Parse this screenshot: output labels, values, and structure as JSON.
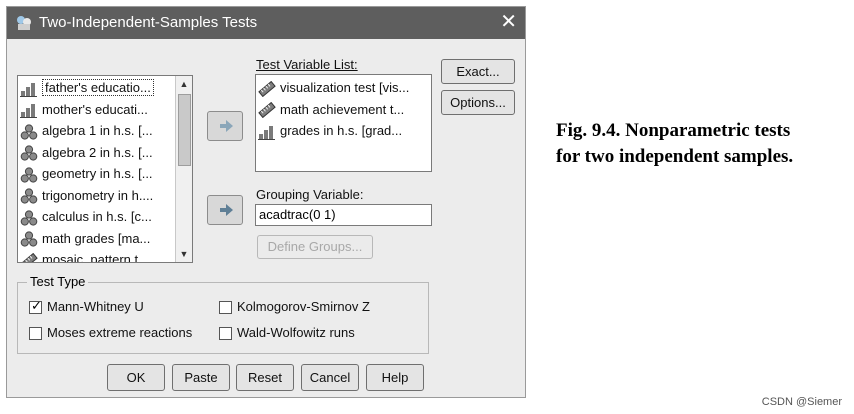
{
  "window": {
    "title": "Two-Independent-Samples Tests",
    "close_symbol": "✕"
  },
  "source_list": {
    "items": [
      {
        "label": "father's educatio...",
        "icon": "ordinal-bar-icon",
        "selected": true
      },
      {
        "label": "mother's educati...",
        "icon": "ordinal-bar-icon"
      },
      {
        "label": "algebra 1 in h.s. [...",
        "icon": "nominal-circles-icon"
      },
      {
        "label": "algebra 2 in h.s. [...",
        "icon": "nominal-circles-icon"
      },
      {
        "label": "geometry in h.s. [...",
        "icon": "nominal-circles-icon"
      },
      {
        "label": "trigonometry in h....",
        "icon": "nominal-circles-icon"
      },
      {
        "label": "calculus in h.s. [c...",
        "icon": "nominal-circles-icon"
      },
      {
        "label": "math grades [ma...",
        "icon": "nominal-circles-icon"
      },
      {
        "label": "mosaic, pattern t...",
        "icon": "scale-ruler-icon"
      }
    ]
  },
  "test_variable_list": {
    "label": "Test Variable List:",
    "items": [
      {
        "label": "visualization test [vis...",
        "icon": "scale-ruler-icon"
      },
      {
        "label": "math achievement t...",
        "icon": "scale-ruler-icon"
      },
      {
        "label": "grades in h.s. [grad...",
        "icon": "ordinal-bar-icon"
      }
    ]
  },
  "grouping": {
    "label": "Grouping Variable:",
    "value": "acadtrac(0 1)"
  },
  "buttons": {
    "exact": "Exact...",
    "options": "Options...",
    "define_groups": "Define Groups...",
    "ok": "OK",
    "paste": "Paste",
    "reset": "Reset",
    "cancel": "Cancel",
    "help": "Help"
  },
  "test_type": {
    "title": "Test Type",
    "options": [
      {
        "label": "Mann-Whitney U",
        "checked": true
      },
      {
        "label": "Kolmogorov-Smirnov Z",
        "checked": false
      },
      {
        "label": "Moses extreme reactions",
        "checked": false
      },
      {
        "label": "Wald-Wolfowitz runs",
        "checked": false
      }
    ]
  },
  "caption": {
    "line1": "Fig. 9.4.  Nonparametric tests",
    "line2": "for two independent samples."
  },
  "watermark": "CSDN @Siemer",
  "colors": {
    "titlebar": "#5e5e5e",
    "dialog_bg": "#ececec",
    "arrow_button": "#d8d8d8"
  }
}
